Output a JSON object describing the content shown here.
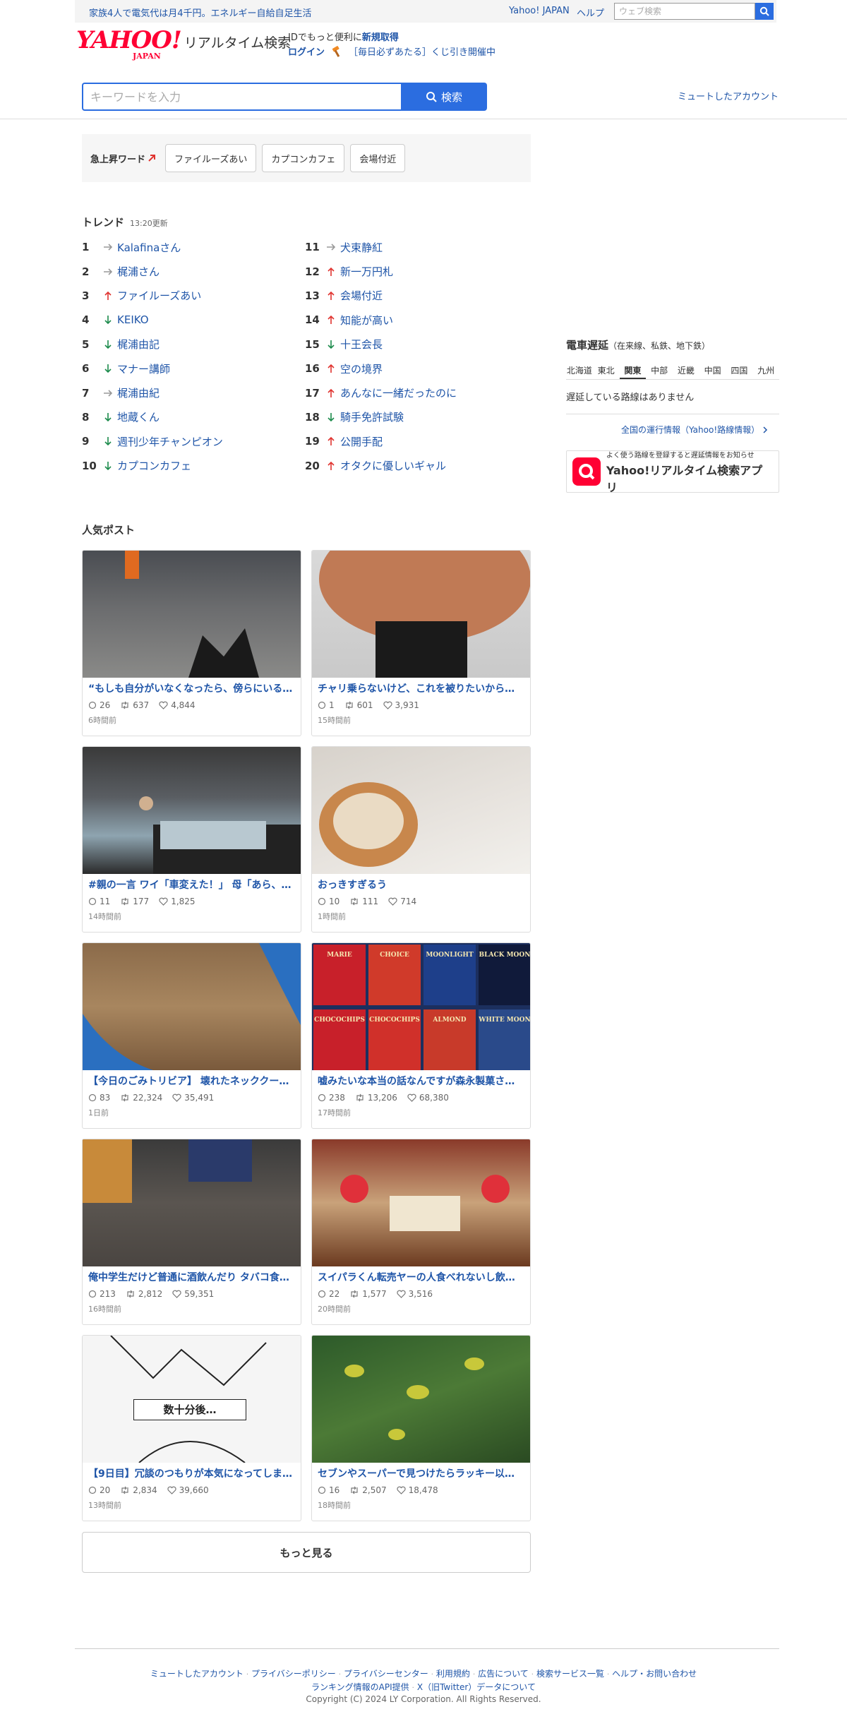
{
  "top": {
    "promo": "家族4人で電気代は月4千円。エネルギー自給自足生活",
    "yahoo_japan": "Yahoo! JAPAN",
    "help": "ヘルプ",
    "web_search_placeholder": "ウェブ検索"
  },
  "header": {
    "logo_text": "YAHOO!",
    "logo_japan": "JAPAN",
    "logo_sub": "リアルタイム検索",
    "id_prefix": "IDでもっと便利に",
    "id_link": "新規取得",
    "login": "ログイン",
    "lottery": "［毎日必ずあたる］くじ引き開催中"
  },
  "search": {
    "placeholder": "キーワードを入力",
    "button": "検索",
    "muted_accounts": "ミュートしたアカウント"
  },
  "rising": {
    "label": "急上昇ワード",
    "chips": [
      "ファイルーズあい",
      "カプコンカフェ",
      "会場付近"
    ]
  },
  "trends": {
    "title": "トレンド",
    "updated": "13:20更新",
    "left": [
      {
        "rank": "1",
        "dir": "flat",
        "word": "Kalafinaさん"
      },
      {
        "rank": "2",
        "dir": "flat",
        "word": "梶浦さん"
      },
      {
        "rank": "3",
        "dir": "up",
        "word": "ファイルーズあい"
      },
      {
        "rank": "4",
        "dir": "down",
        "word": "KEIKO"
      },
      {
        "rank": "5",
        "dir": "down",
        "word": "梶浦由記"
      },
      {
        "rank": "6",
        "dir": "down",
        "word": "マナー講師"
      },
      {
        "rank": "7",
        "dir": "flat",
        "word": "梶浦由紀"
      },
      {
        "rank": "8",
        "dir": "down",
        "word": "地蔵くん"
      },
      {
        "rank": "9",
        "dir": "down",
        "word": "週刊少年チャンピオン"
      },
      {
        "rank": "10",
        "dir": "down",
        "word": "カプコンカフェ"
      }
    ],
    "right": [
      {
        "rank": "11",
        "dir": "flat",
        "word": "犬束静紅"
      },
      {
        "rank": "12",
        "dir": "up",
        "word": "新一万円札"
      },
      {
        "rank": "13",
        "dir": "up",
        "word": "会場付近"
      },
      {
        "rank": "14",
        "dir": "up",
        "word": "知能が高い"
      },
      {
        "rank": "15",
        "dir": "down",
        "word": "十王会長"
      },
      {
        "rank": "16",
        "dir": "up",
        "word": "空の境界"
      },
      {
        "rank": "17",
        "dir": "up",
        "word": "あんなに一緒だったのに"
      },
      {
        "rank": "18",
        "dir": "down",
        "word": "騎手免許試験"
      },
      {
        "rank": "19",
        "dir": "up",
        "word": "公開手配"
      },
      {
        "rank": "20",
        "dir": "up",
        "word": "オタクに優しいギャル"
      }
    ]
  },
  "posts": {
    "title": "人気ポスト",
    "items": [
      {
        "title": "“もしも自分がいなくなったら、傍らにいる…",
        "replies": "26",
        "reposts": "637",
        "likes": "4,844",
        "time": "6時間前"
      },
      {
        "title": "チャリ乗らないけど、これを被りたいから…",
        "replies": "1",
        "reposts": "601",
        "likes": "3,931",
        "time": "15時間前"
      },
      {
        "title": "#親の一言 ワイ「車変えた！」 母「あら、…",
        "replies": "11",
        "reposts": "177",
        "likes": "1,825",
        "time": "14時間前"
      },
      {
        "title": "おっきすぎるう",
        "replies": "10",
        "reposts": "111",
        "likes": "714",
        "time": "1時間前"
      },
      {
        "title": "【今日のごみトリビア】 壊れたネッククー…",
        "replies": "83",
        "reposts": "22,324",
        "likes": "35,491",
        "time": "1日前"
      },
      {
        "title": "嘘みたいな本当の話なんですが森永製菓さ…",
        "replies": "238",
        "reposts": "13,206",
        "likes": "68,380",
        "time": "17時間前"
      },
      {
        "title": "俺中学生だけど普通に酒飲んだり タバコ食…",
        "replies": "213",
        "reposts": "2,812",
        "likes": "59,351",
        "time": "16時間前"
      },
      {
        "title": "スイパラくん󠄀転売ヤーの人食べれないし飲…",
        "replies": "22",
        "reposts": "1,577",
        "likes": "3,516",
        "time": "20時間前"
      },
      {
        "title": "【9日目】冗談のつもりが本気になってしま…",
        "replies": "20",
        "reposts": "2,834",
        "likes": "39,660",
        "time": "13時間前"
      },
      {
        "title": "セブンやスーパーで見つけたらラッキー以…",
        "replies": "16",
        "reposts": "2,507",
        "likes": "18,478",
        "time": "18時間前"
      }
    ],
    "image_texts": {
      "cookie_1": "MARIE",
      "cookie_2": "CHOICE",
      "cookie_3": "MOONLIGHT",
      "cookie_4": "BLACK MOON",
      "cookie_5": "CHOCOCHIPS",
      "cookie_6": "CHOCOCHIPS",
      "cookie_7": "ALMOND",
      "cookie_8": "WHITE MOON",
      "manga_caption": "数十分後…"
    },
    "more": "もっと見る"
  },
  "train": {
    "title": "電車遅延",
    "subtitle": "（在来線、私鉄、地下鉄）",
    "tabs": [
      "北海道",
      "東北",
      "関東",
      "中部",
      "近畿",
      "中国",
      "四国",
      "九州"
    ],
    "active_tab": "関東",
    "status": "遅延している路線はありません",
    "link": "全国の運行情報（Yahoo!路線情報）"
  },
  "app": {
    "sub": "よく使う路線を登録すると遅延情報をお知らせ",
    "name": "Yahoo!リアルタイム検索アプリ"
  },
  "footer": {
    "links1": [
      "ミュートしたアカウント",
      "プライバシーポリシー",
      "プライバシーセンター",
      "利用規約",
      "広告について",
      "検索サービス一覧",
      "ヘルプ・お問い合わせ"
    ],
    "links2": [
      "ランキング情報のAPI提供",
      "X（旧Twitter）データについて"
    ],
    "copyright": "Copyright (C) 2024 LY Corporation. All Rights Reserved."
  },
  "colors": {
    "link": "#1f55a8",
    "accent": "#2b6de0",
    "brand": "#ff0033",
    "up": "#e0332f",
    "down": "#1b8a4b",
    "flat": "#999999"
  }
}
